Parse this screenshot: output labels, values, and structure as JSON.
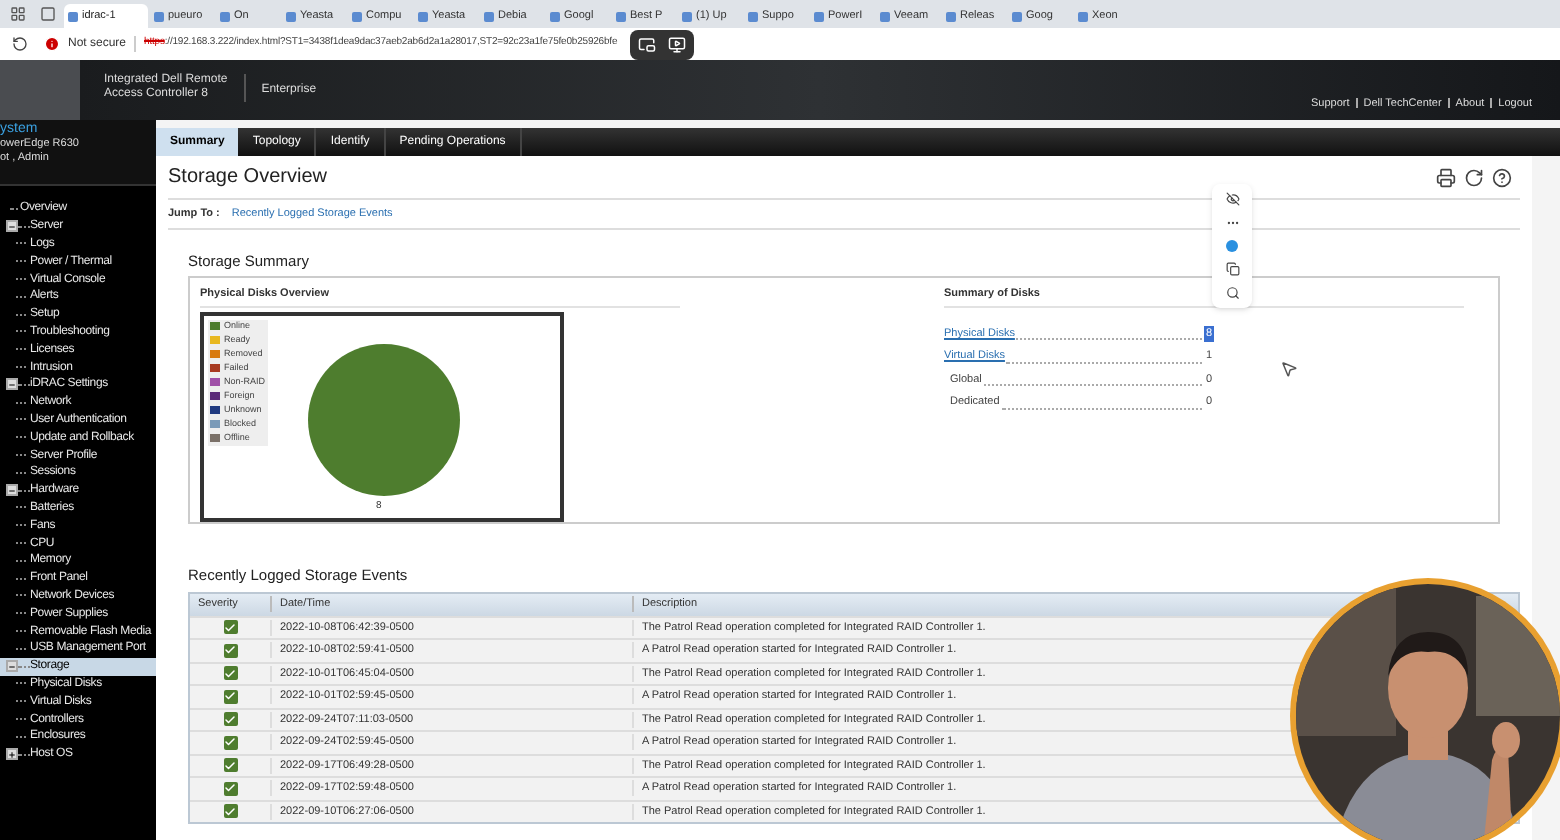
{
  "browser": {
    "tabs": [
      {
        "label": "idrac-1",
        "selected": true
      },
      {
        "label": "pueuro",
        "selected": false
      },
      {
        "label": "On",
        "selected": false
      },
      {
        "label": "Yeasta",
        "selected": false
      },
      {
        "label": "Compu",
        "selected": false
      },
      {
        "label": "Yeasta",
        "selected": false
      },
      {
        "label": "Debia",
        "selected": false
      },
      {
        "label": "Googl",
        "selected": false
      },
      {
        "label": "Best P",
        "selected": false
      },
      {
        "label": "(1) Up",
        "selected": false
      },
      {
        "label": "Suppo",
        "selected": false
      },
      {
        "label": "PowerI",
        "selected": false
      },
      {
        "label": "Veeam",
        "selected": false
      },
      {
        "label": "Releas",
        "selected": false
      },
      {
        "label": "Goog",
        "selected": false
      },
      {
        "label": "Xeon",
        "selected": false
      }
    ],
    "security": "Not secure",
    "url_scheme": "https",
    "url_rest": "://192.168.3.222/index.html?ST1=3438f1dea9dac37aeb2ab6d2a1a28017,ST2=92c23a1fe75fe0b25926bfe"
  },
  "header": {
    "product_lines": [
      "Integrated Dell Remote",
      "Access Controller 8"
    ],
    "edition": "Enterprise",
    "links": [
      "Support",
      "Dell TechCenter",
      "About",
      "Logout"
    ]
  },
  "sidebar": {
    "title": "ystem",
    "model": "owerEdge R630",
    "user": "ot , Admin",
    "tree": [
      {
        "label": "Overview",
        "selected": false
      },
      {
        "label": "Server",
        "selected": false,
        "expanded": true,
        "children": [
          {
            "label": "Logs",
            "selected": false
          },
          {
            "label": "Power / Thermal",
            "selected": false
          },
          {
            "label": "Virtual Console",
            "selected": false
          },
          {
            "label": "Alerts",
            "selected": false
          },
          {
            "label": "Setup",
            "selected": false
          },
          {
            "label": "Troubleshooting",
            "selected": false
          },
          {
            "label": "Licenses",
            "selected": false
          },
          {
            "label": "Intrusion",
            "selected": false
          }
        ]
      },
      {
        "label": "iDRAC Settings",
        "selected": false,
        "expanded": true,
        "children": [
          {
            "label": "Network",
            "selected": false
          },
          {
            "label": "User Authentication",
            "selected": false
          },
          {
            "label": "Update and Rollback",
            "selected": false
          },
          {
            "label": "Server Profile",
            "selected": false
          },
          {
            "label": "Sessions",
            "selected": false
          }
        ]
      },
      {
        "label": "Hardware",
        "selected": false,
        "expanded": true,
        "children": [
          {
            "label": "Batteries",
            "selected": false
          },
          {
            "label": "Fans",
            "selected": false
          },
          {
            "label": "CPU",
            "selected": false
          },
          {
            "label": "Memory",
            "selected": false
          },
          {
            "label": "Front Panel",
            "selected": false
          },
          {
            "label": "Network Devices",
            "selected": false
          },
          {
            "label": "Power Supplies",
            "selected": false
          },
          {
            "label": "Removable Flash Media",
            "selected": false
          },
          {
            "label": "USB Management Port",
            "selected": false
          }
        ]
      },
      {
        "label": "Storage",
        "selected": true,
        "expanded": true,
        "children": [
          {
            "label": "Physical Disks",
            "selected": false
          },
          {
            "label": "Virtual Disks",
            "selected": false
          },
          {
            "label": "Controllers",
            "selected": false
          },
          {
            "label": "Enclosures",
            "selected": false
          }
        ]
      },
      {
        "label": "Host OS",
        "selected": false,
        "expanded": false
      }
    ]
  },
  "tabs": [
    {
      "label": "Summary",
      "selected": true
    },
    {
      "label": "Topology",
      "selected": false
    },
    {
      "label": "Identify",
      "selected": false
    },
    {
      "label": "Pending Operations",
      "selected": false
    }
  ],
  "page": {
    "title": "Storage Overview",
    "jump_label": "Jump To :",
    "jump_link": "Recently Logged Storage Events"
  },
  "summary": {
    "title": "Storage Summary",
    "overview_title": "Physical Disks Overview",
    "legend": [
      {
        "label": "Online",
        "color": "#4e7d2e"
      },
      {
        "label": "Ready",
        "color": "#e8b820"
      },
      {
        "label": "Removed",
        "color": "#d87a10"
      },
      {
        "label": "Failed",
        "color": "#a83a20"
      },
      {
        "label": "Non-RAID",
        "color": "#a050a8"
      },
      {
        "label": "Foreign",
        "color": "#5a2a78"
      },
      {
        "label": "Unknown",
        "color": "#203a80"
      },
      {
        "label": "Blocked",
        "color": "#7a9ab8"
      },
      {
        "label": "Offline",
        "color": "#7a7068"
      }
    ],
    "chart_data": {
      "type": "pie",
      "values": [
        8
      ],
      "data_labels": true
    },
    "disks_title": "Summary of Disks",
    "disk_rows": [
      {
        "kind": "link",
        "label": "Physical Disks",
        "value": "8",
        "highlighted": true
      },
      {
        "kind": "link",
        "label": "Virtual Disks",
        "value": "1",
        "highlighted": false
      },
      {
        "kind": "sub",
        "label": "Global",
        "value": "0",
        "highlighted": false
      },
      {
        "kind": "sub",
        "label": "Dedicated",
        "value": "0",
        "highlighted": false
      }
    ]
  },
  "events": {
    "title": "Recently Logged Storage Events",
    "columns": [
      "Severity",
      "Date/Time",
      "Description"
    ],
    "rows": [
      {
        "kind": "ok",
        "datetime": "2022-10-08T06:42:39-0500",
        "description": "The Patrol Read operation completed for Integrated RAID Controller 1."
      },
      {
        "kind": "ok",
        "datetime": "2022-10-08T02:59:41-0500",
        "description": "A Patrol Read operation started for Integrated RAID Controller 1."
      },
      {
        "kind": "ok",
        "datetime": "2022-10-01T06:45:04-0500",
        "description": "The Patrol Read operation completed for Integrated RAID Controller 1."
      },
      {
        "kind": "ok",
        "datetime": "2022-10-01T02:59:45-0500",
        "description": "A Patrol Read operation started for Integrated RAID Controller 1."
      },
      {
        "kind": "ok",
        "datetime": "2022-09-24T07:11:03-0500",
        "description": "The Patrol Read operation completed for Integrated RAID Controller 1."
      },
      {
        "kind": "ok",
        "datetime": "2022-09-24T02:59:45-0500",
        "description": "A Patrol Read operation started for Integrated RAID Controller 1."
      },
      {
        "kind": "ok",
        "datetime": "2022-09-17T06:49:28-0500",
        "description": "The Patrol Read operation completed for Integrated RAID Controller 1."
      },
      {
        "kind": "ok",
        "datetime": "2022-09-17T02:59:48-0500",
        "description": "A Patrol Read operation started for Integrated RAID Controller 1."
      },
      {
        "kind": "ok",
        "datetime": "2022-09-10T06:27:06-0500",
        "description": "The Patrol Read operation completed for Integrated RAID Controller 1."
      }
    ]
  }
}
